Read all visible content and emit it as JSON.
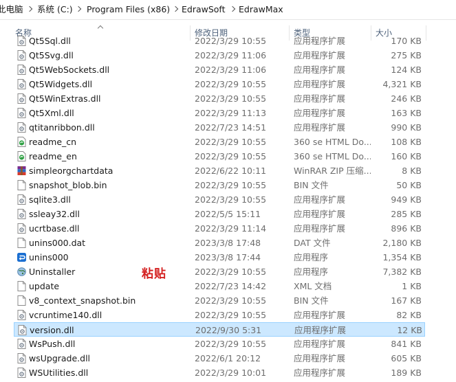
{
  "breadcrumb": [
    "此电脑",
    "系统 (C:)",
    "Program Files (x86)",
    "EdrawSoft",
    "EdrawMax"
  ],
  "columns": {
    "name": "名称",
    "date": "修改日期",
    "type": "类型",
    "size": "大小"
  },
  "annotation": "粘贴",
  "selected_color": "#cce8ff",
  "rows": [
    {
      "name": "Qt5Sql.dll",
      "date": "2022/3/29 10:55",
      "type": "应用程序扩展",
      "size": "170 KB",
      "icon": "dll-icon"
    },
    {
      "name": "Qt5Svg.dll",
      "date": "2022/3/29 11:06",
      "type": "应用程序扩展",
      "size": "275 KB",
      "icon": "dll-icon"
    },
    {
      "name": "Qt5WebSockets.dll",
      "date": "2022/3/29 11:06",
      "type": "应用程序扩展",
      "size": "124 KB",
      "icon": "dll-icon"
    },
    {
      "name": "Qt5Widgets.dll",
      "date": "2022/3/29 10:55",
      "type": "应用程序扩展",
      "size": "4,321 KB",
      "icon": "dll-icon"
    },
    {
      "name": "Qt5WinExtras.dll",
      "date": "2022/3/29 10:55",
      "type": "应用程序扩展",
      "size": "246 KB",
      "icon": "dll-icon"
    },
    {
      "name": "Qt5Xml.dll",
      "date": "2022/3/29 11:13",
      "type": "应用程序扩展",
      "size": "163 KB",
      "icon": "dll-icon"
    },
    {
      "name": "qtitanribbon.dll",
      "date": "2022/7/23 14:51",
      "type": "应用程序扩展",
      "size": "990 KB",
      "icon": "dll-icon"
    },
    {
      "name": "readme_cn",
      "date": "2022/3/29 10:55",
      "type": "360 se HTML Do...",
      "size": "108 KB",
      "icon": "html-doc-icon"
    },
    {
      "name": "readme_en",
      "date": "2022/3/29 10:55",
      "type": "360 se HTML Do...",
      "size": "160 KB",
      "icon": "html-doc-icon"
    },
    {
      "name": "simpleorgchartdata",
      "date": "2022/6/22 10:11",
      "type": "WinRAR ZIP 压缩...",
      "size": "8 KB",
      "icon": "winrar-archive-icon"
    },
    {
      "name": "snapshot_blob.bin",
      "date": "2022/3/29 10:55",
      "type": "BIN 文件",
      "size": "50 KB",
      "icon": "blank-file-icon"
    },
    {
      "name": "sqlite3.dll",
      "date": "2022/3/29 10:55",
      "type": "应用程序扩展",
      "size": "949 KB",
      "icon": "dll-icon"
    },
    {
      "name": "ssleay32.dll",
      "date": "2022/5/5 15:11",
      "type": "应用程序扩展",
      "size": "285 KB",
      "icon": "dll-icon"
    },
    {
      "name": "ucrtbase.dll",
      "date": "2022/3/29 11:14",
      "type": "应用程序扩展",
      "size": "896 KB",
      "icon": "dll-icon"
    },
    {
      "name": "unins000.dat",
      "date": "2023/3/8 17:48",
      "type": "DAT 文件",
      "size": "2,180 KB",
      "icon": "blank-file-icon"
    },
    {
      "name": "unins000",
      "date": "2023/3/8 17:44",
      "type": "应用程序",
      "size": "1,354 KB",
      "icon": "uninstaller-app-icon"
    },
    {
      "name": "Uninstaller",
      "date": "2022/3/29 10:55",
      "type": "应用程序",
      "size": "7,382 KB",
      "icon": "globe-app-icon"
    },
    {
      "name": "update",
      "date": "2022/7/23 14:42",
      "type": "XML 文档",
      "size": "1 KB",
      "icon": "blank-file-icon"
    },
    {
      "name": "v8_context_snapshot.bin",
      "date": "2022/3/29 10:55",
      "type": "BIN 文件",
      "size": "167 KB",
      "icon": "blank-file-icon"
    },
    {
      "name": "vcruntime140.dll",
      "date": "2022/3/29 10:55",
      "type": "应用程序扩展",
      "size": "82 KB",
      "icon": "dll-icon"
    },
    {
      "name": "version.dll",
      "date": "2022/9/30 5:31",
      "type": "应用程序扩展",
      "size": "12 KB",
      "icon": "dll-icon",
      "selected": true
    },
    {
      "name": "WsPush.dll",
      "date": "2022/3/29 10:55",
      "type": "应用程序扩展",
      "size": "841 KB",
      "icon": "dll-icon"
    },
    {
      "name": "wsUpgrade.dll",
      "date": "2022/6/1 20:12",
      "type": "应用程序扩展",
      "size": "605 KB",
      "icon": "dll-icon"
    },
    {
      "name": "WSUtilities.dll",
      "date": "2022/3/29 10:01",
      "type": "应用程序扩展",
      "size": "189 KB",
      "icon": "dll-icon"
    }
  ]
}
